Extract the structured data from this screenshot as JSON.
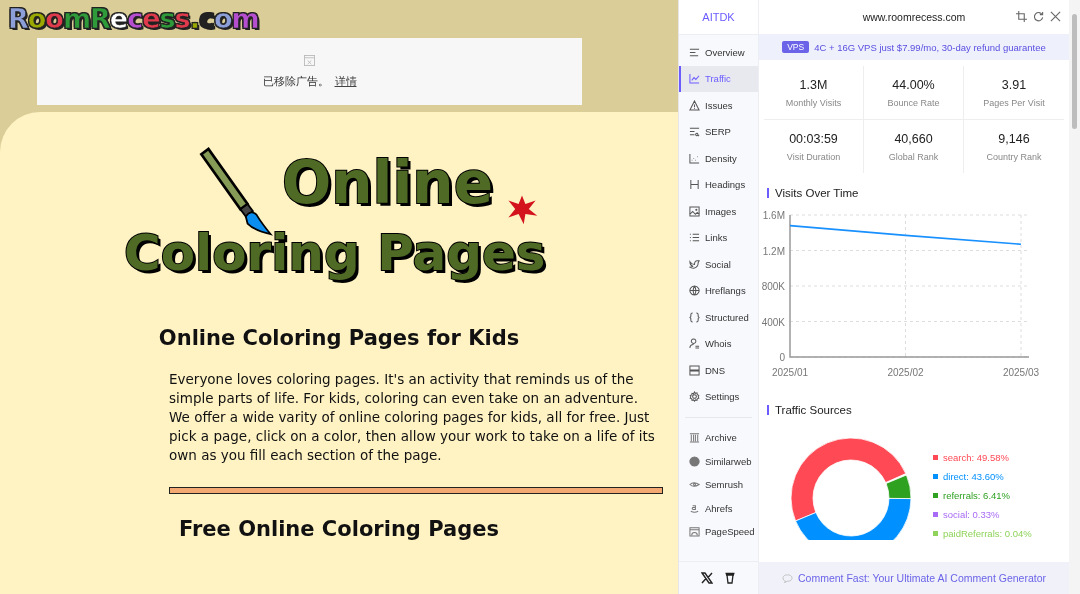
{
  "site": {
    "logo": "RoomRecess.com",
    "ad_notice": {
      "text": "已移除广告。",
      "link": "详情"
    },
    "banner_title": [
      "Online",
      "Coloring Pages"
    ],
    "heading": "Online Coloring Pages for Kids",
    "paragraph": "Everyone loves coloring pages. It's an activity that reminds us of the simple parts of life. For kids, coloring can even take on an adventure. We offer a wide varity of online coloring pages for kids, all for free. Just pick a page, click on a color, then allow your work to take on a life of its own as you fill each section of the page.",
    "subheading": "Free Online Coloring Pages"
  },
  "panel": {
    "brand": "AITDK",
    "domain": "www.roomrecess.com",
    "nav": [
      {
        "label": "Overview",
        "selected": false
      },
      {
        "label": "Traffic",
        "selected": true
      },
      {
        "label": "Issues",
        "selected": false
      },
      {
        "label": "SERP",
        "selected": false
      },
      {
        "label": "Density",
        "selected": false
      },
      {
        "label": "Headings",
        "selected": false
      },
      {
        "label": "Images",
        "selected": false
      },
      {
        "label": "Links",
        "selected": false
      },
      {
        "label": "Social",
        "selected": false
      },
      {
        "label": "Hreflangs",
        "selected": false
      },
      {
        "label": "Structured",
        "selected": false
      },
      {
        "label": "Whois",
        "selected": false
      },
      {
        "label": "DNS",
        "selected": false
      },
      {
        "label": "Settings",
        "selected": false
      }
    ],
    "tools": [
      "Archive",
      "Similarweb",
      "Semrush",
      "Ahrefs",
      "PageSpeed"
    ],
    "promo": {
      "badge": "VPS",
      "text": "4C + 16G VPS just $7.99/mo, 30-day refund guarantee"
    },
    "stats": [
      {
        "value": "1.3M",
        "label": "Monthly Visits"
      },
      {
        "value": "44.00%",
        "label": "Bounce Rate"
      },
      {
        "value": "3.91",
        "label": "Pages Per Visit"
      },
      {
        "value": "00:03:59",
        "label": "Visit Duration"
      },
      {
        "value": "40,660",
        "label": "Global Rank"
      },
      {
        "value": "9,146",
        "label": "Country Rank"
      }
    ],
    "visits": {
      "title": "Visits Over Time",
      "chart_data": {
        "type": "line",
        "categories": [
          "2025/01",
          "2025/02",
          "2025/03"
        ],
        "series": [
          {
            "color": "#1890ff",
            "values": [
              1480000,
              1370000,
              1270000
            ]
          }
        ],
        "ylim": [
          0,
          1600000
        ],
        "grid": true,
        "yticks": [
          {
            "value": 0,
            "label": "0"
          },
          {
            "value": 400000,
            "label": "400K"
          },
          {
            "value": 800000,
            "label": "800K"
          },
          {
            "value": 1200000,
            "label": "1.2M"
          },
          {
            "value": 1600000,
            "label": "1.6M"
          }
        ]
      }
    },
    "sources": {
      "title": "Traffic Sources",
      "chart_data": {
        "type": "donut",
        "values": [
          49.58,
          43.6,
          6.41
        ]
      },
      "legend": [
        {
          "label": "search: 49.58%",
          "color": "#ff4a55"
        },
        {
          "label": "direct: 43.60%",
          "color": "#0090ff"
        },
        {
          "label": "referrals: 6.41%",
          "color": "#2ea121"
        },
        {
          "label": "social: 0.33%",
          "color": "#a86bf5"
        },
        {
          "label": "paidReferrals: 0.04%",
          "color": "#8fd35a"
        }
      ]
    },
    "footer_text": "Comment Fast: Your Ultimate AI Comment Generator"
  }
}
